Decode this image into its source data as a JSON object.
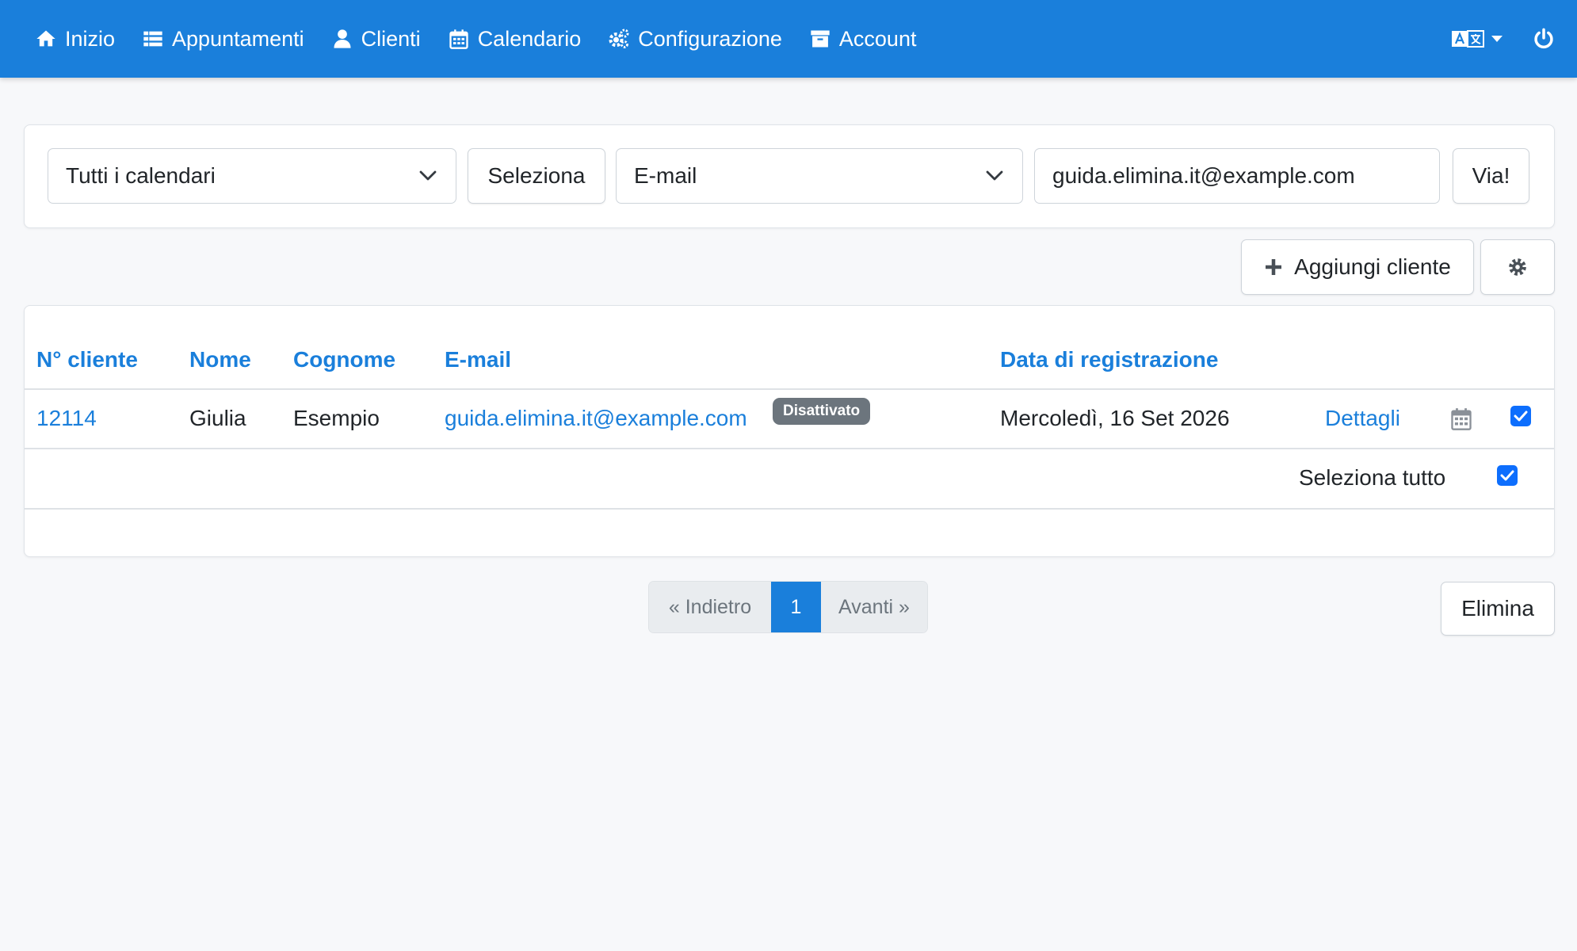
{
  "nav": {
    "items": [
      {
        "label": "Inizio",
        "icon": "home-icon"
      },
      {
        "label": "Appuntamenti",
        "icon": "list-icon"
      },
      {
        "label": "Clienti",
        "icon": "user-icon"
      },
      {
        "label": "Calendario",
        "icon": "calendar-icon"
      },
      {
        "label": "Configurazione",
        "icon": "cogs-icon"
      },
      {
        "label": "Account",
        "icon": "archive-icon"
      }
    ],
    "language_icon": "language-icon",
    "power_icon": "power-icon"
  },
  "filters": {
    "calendar_select": "Tutti i calendari",
    "select_button": "Seleziona",
    "field_select": "E-mail",
    "search_value": "guida.elimina.it@example.com",
    "go_button": "Via!"
  },
  "toolbar": {
    "add_client": "Aggiungi cliente"
  },
  "table": {
    "headers": [
      "N° cliente",
      "Nome",
      "Cognome",
      "E-mail",
      "Data di registrazione"
    ],
    "rows": [
      {
        "id": "12114",
        "first_name": "Giulia",
        "last_name": "Esempio",
        "email": "guida.elimina.it@example.com",
        "badge": "Disattivato",
        "registered": "Mercoledì, 16 Set 2026",
        "details": "Dettagli",
        "checked": true
      }
    ],
    "select_all": "Seleziona tutto"
  },
  "pagination": {
    "prev": "« Indietro",
    "current": "1",
    "next": "Avanti »"
  },
  "delete_button": "Elimina",
  "colors": {
    "primary": "#1a7fdb",
    "checkbox": "#0d6efd",
    "badge": "#6c757d",
    "background": "#f7f8fa"
  }
}
